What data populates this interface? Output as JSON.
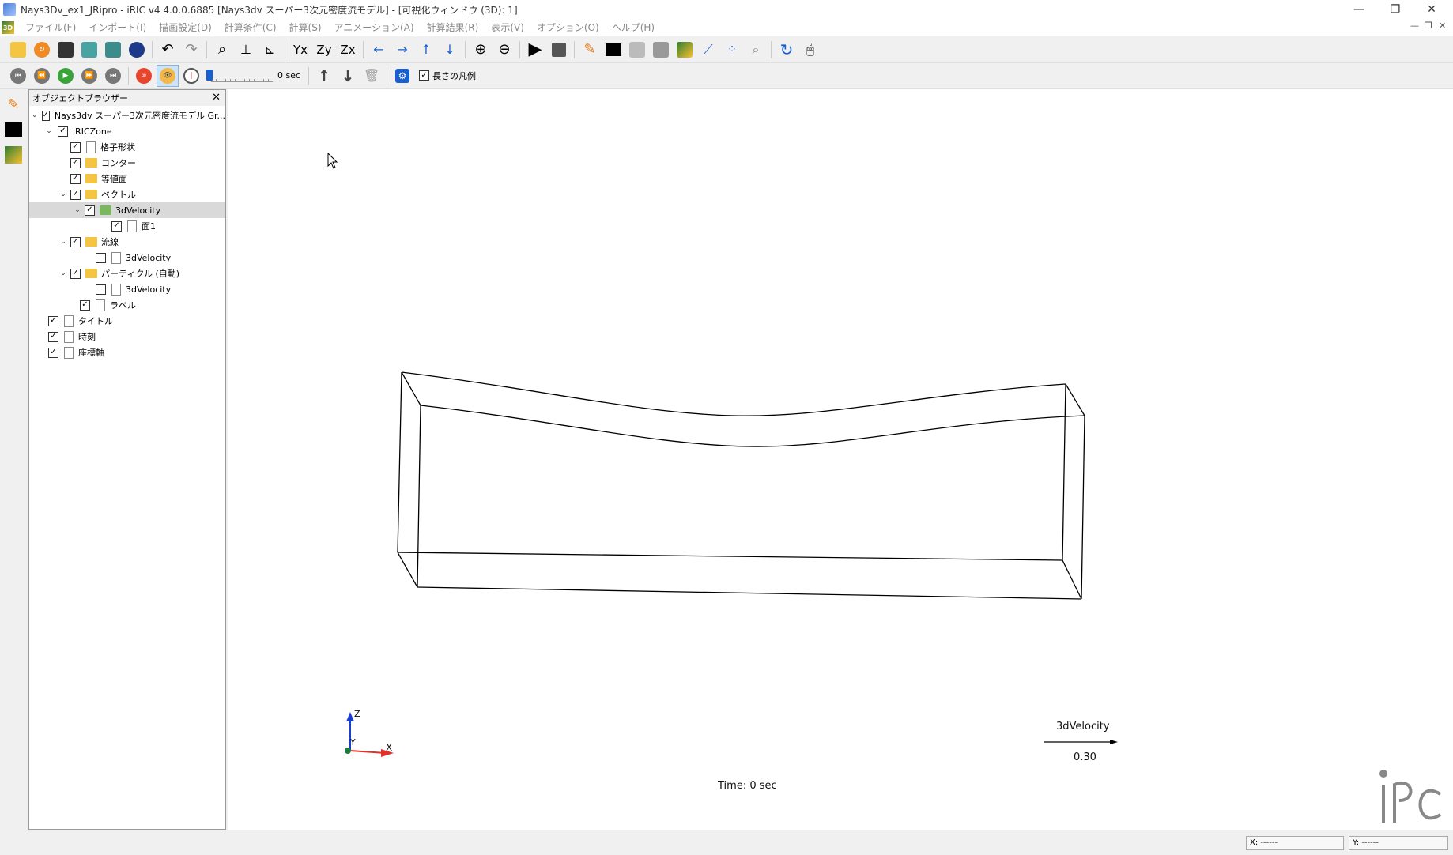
{
  "window": {
    "title": "Nays3Dv_ex1_JRipro - iRIC v4 4.0.0.6885 [Nays3dv スーパー3次元密度流モデル] - [可視化ウィンドウ (3D): 1]",
    "minimize": "—",
    "restore": "❐",
    "close": "✕",
    "mdi_min": "—",
    "mdi_restore": "❐",
    "mdi_close": "✕"
  },
  "menu": {
    "items": [
      "ファイル(F)",
      "インポート(I)",
      "描画設定(D)",
      "計算条件(C)",
      "計算(S)",
      "アニメーション(A)",
      "計算結果(R)",
      "表示(V)",
      "オプション(O)",
      "ヘルプ(H)"
    ]
  },
  "toolbar2": {
    "time_label": "0 sec",
    "length_legend_label": "長さの凡例"
  },
  "object_browser": {
    "title": "オブジェクトブラウザー",
    "close": "✕",
    "items": {
      "root": "Nays3dv スーパー3次元密度流モデル Gr...",
      "zone": "iRICZone",
      "grid_shape": "格子形状",
      "contour": "コンター",
      "isosurface": "等値面",
      "vector": "ベクトル",
      "vector_velocity": "3dVelocity",
      "face1": "面1",
      "streamline": "流線",
      "streamline_velocity": "3dVelocity",
      "particle": "パーティクル (自動)",
      "particle_velocity": "3dVelocity",
      "label": "ラベル",
      "title": "タイトル",
      "time": "時刻",
      "axes": "座標軸"
    }
  },
  "viewport": {
    "axis_z": "Z",
    "axis_y": "Y",
    "axis_x": "X",
    "legend_title": "3dVelocity",
    "legend_value": "0.30",
    "time_text": "Time: 0 sec",
    "logo": "iRIC"
  },
  "status": {
    "x": "X: ------",
    "y": "Y: ------"
  }
}
